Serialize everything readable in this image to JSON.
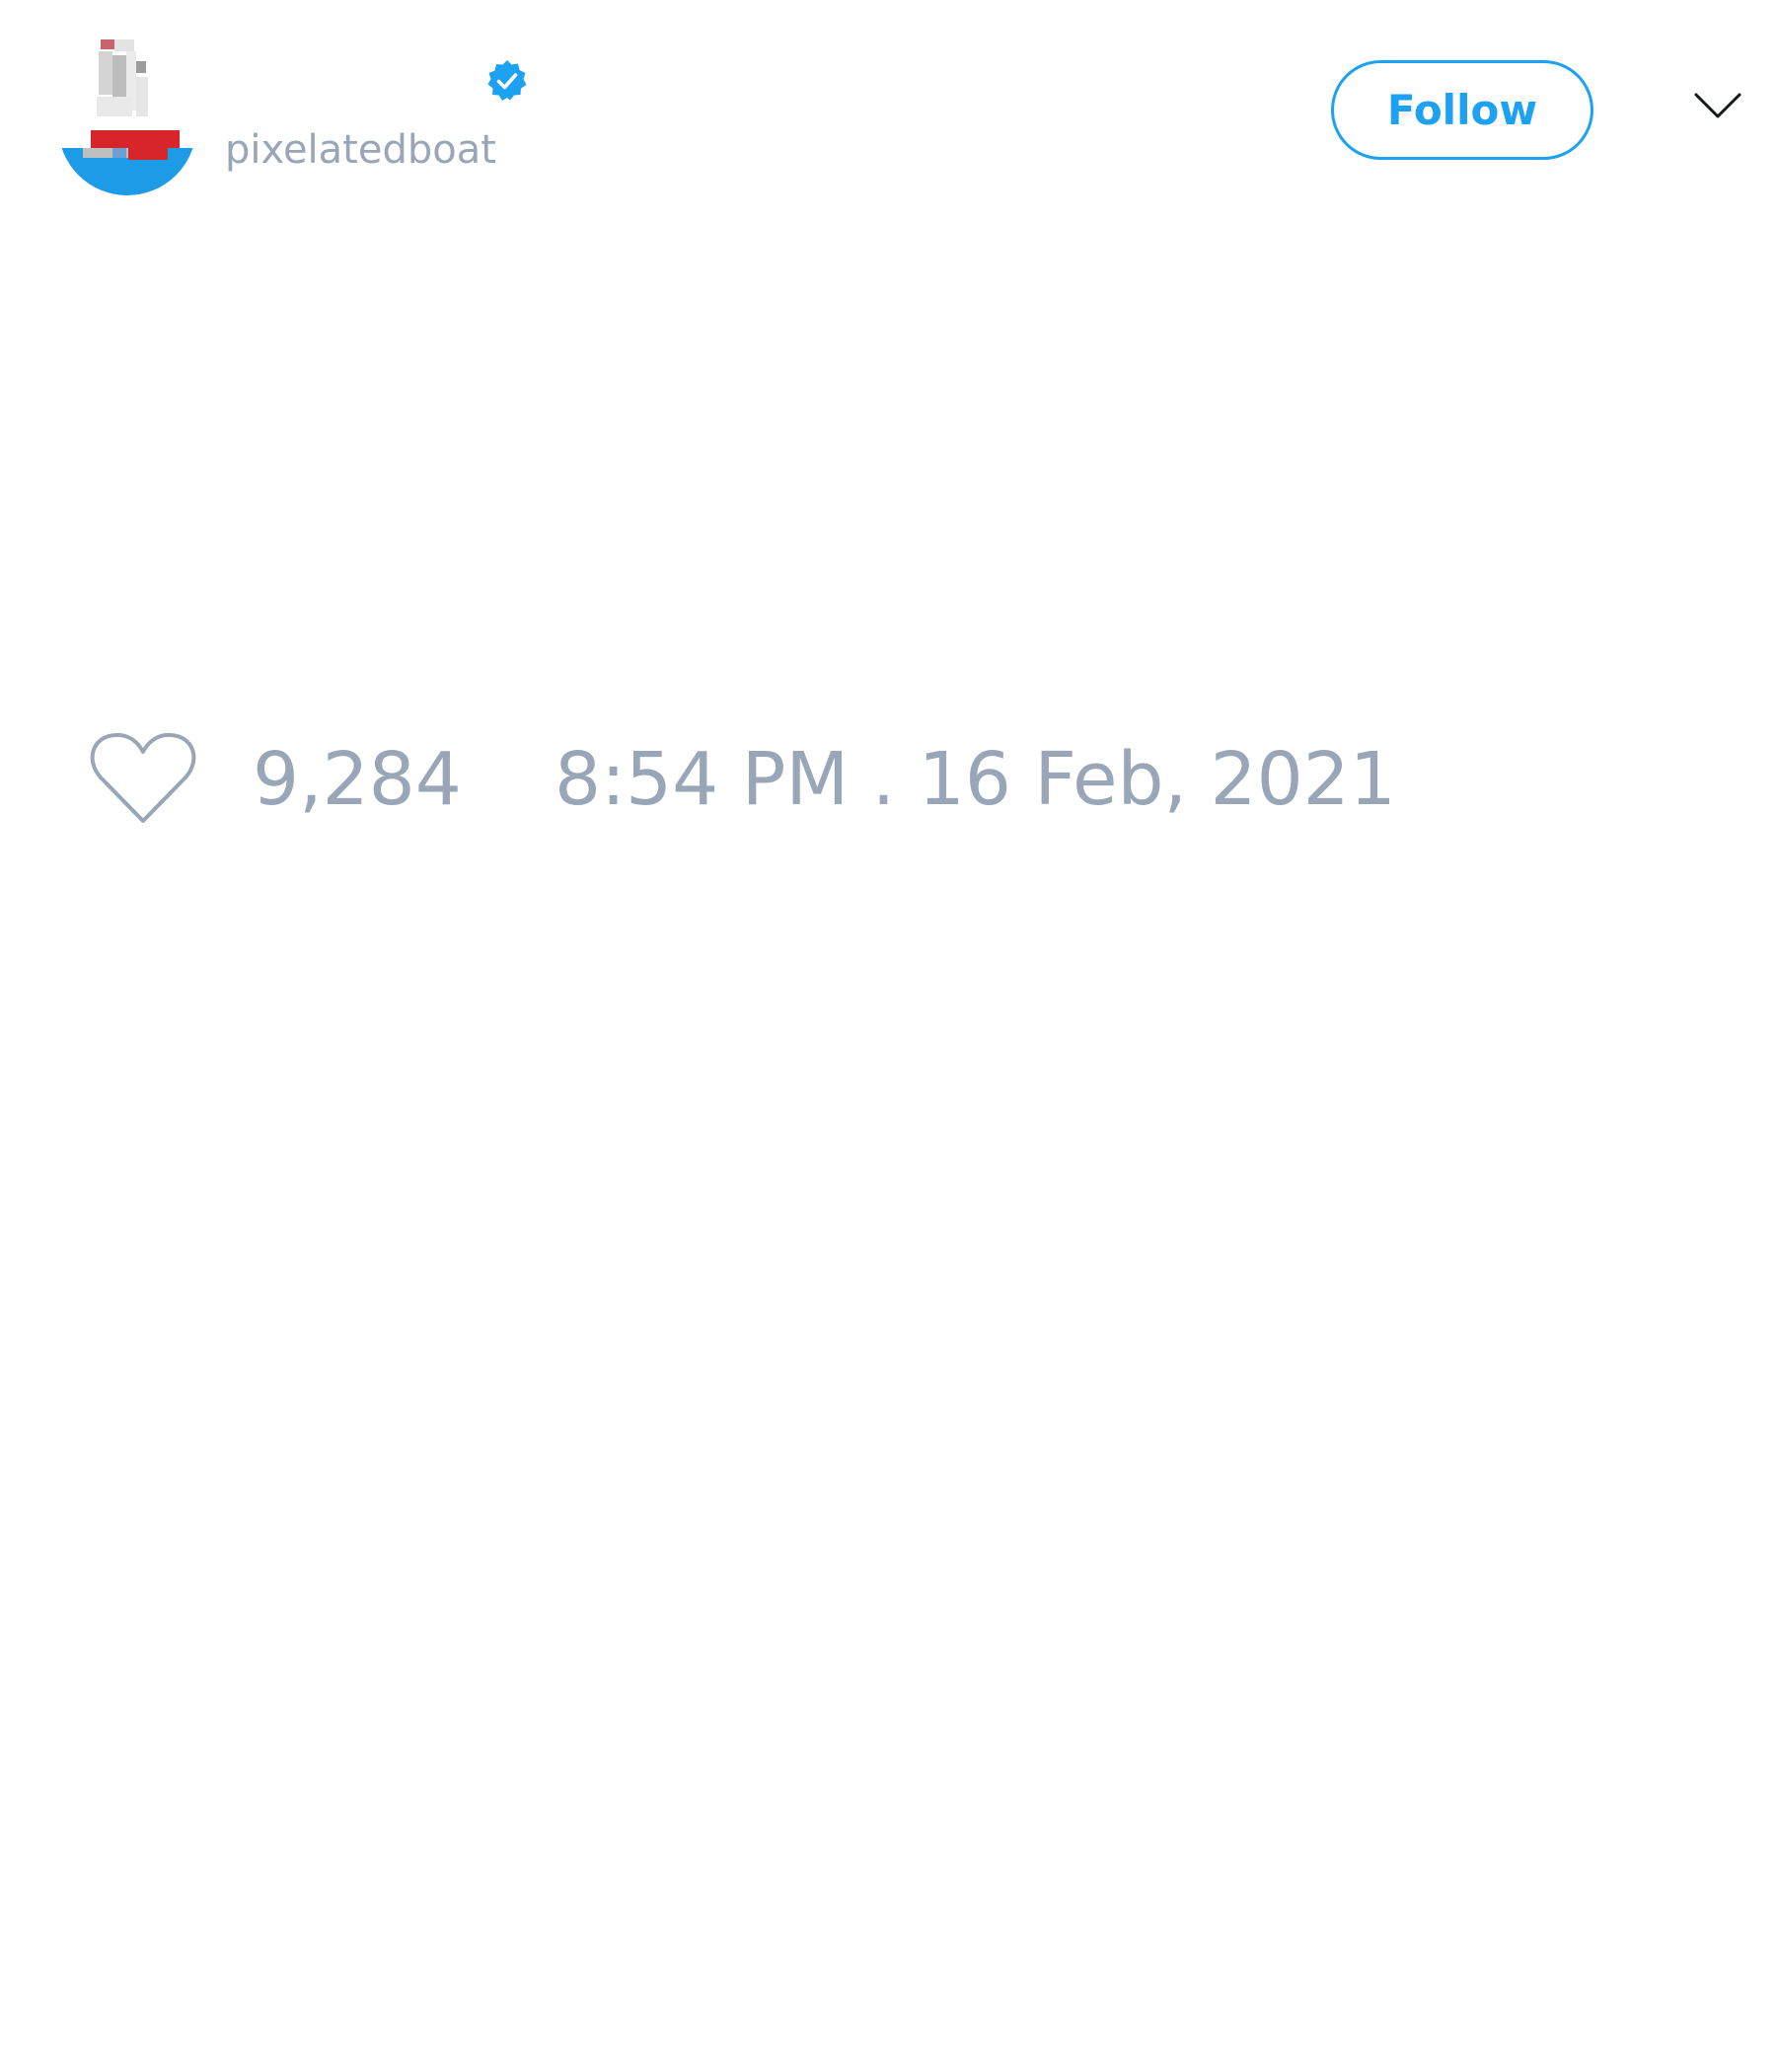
{
  "tweet": {
    "author": {
      "handle": "pixelatedboat",
      "verified": true,
      "avatar_icon": "pixel-boat-avatar"
    },
    "follow_label": "Follow",
    "more_icon": "chevron-down-icon",
    "likes": "9,284",
    "timestamp": "8:54 PM . 16 Feb, 2021"
  },
  "colors": {
    "accent": "#1da1f2",
    "muted_text": "#98a6b8",
    "background": "#ffffff"
  }
}
